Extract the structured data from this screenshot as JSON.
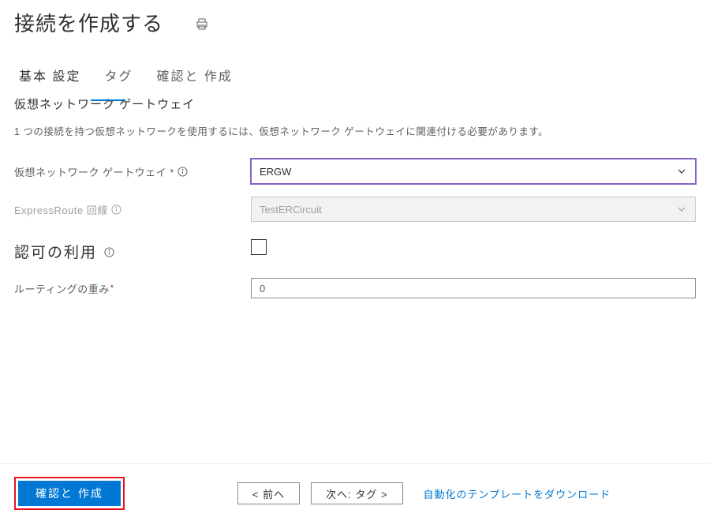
{
  "header": {
    "title": "接続を作成する"
  },
  "tabs": {
    "basic": "基本 設定",
    "tags": "タグ",
    "review": "確認と 作成"
  },
  "section_vnet_gateway": {
    "heading": "仮想ネットワーク ゲートウェイ",
    "description": "1 つの接続を持つ仮想ネットワークを使用するには、仮想ネットワーク ゲートウェイに関連付ける必要があります。"
  },
  "fields": {
    "vnet_gateway": {
      "label": "仮想ネットワーク ゲートウェイ *",
      "value": "ERGW"
    },
    "expressroute_circuit": {
      "label": "ExpressRoute 回線",
      "value": "TestERCircuit"
    },
    "authorization_usage": {
      "label": "認可の利用"
    },
    "routing_weight": {
      "label": "ルーティングの重み",
      "value": "0"
    }
  },
  "footer": {
    "review_create": "確認と 作成",
    "previous": "<  前へ",
    "next": "次へ: タグ >",
    "download_template": "自動化のテンプレートをダウンロード"
  }
}
